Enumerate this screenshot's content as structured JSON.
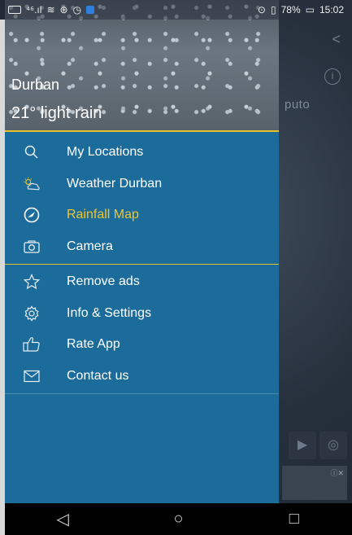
{
  "status_bar": {
    "left_icons": [
      "sim-icon",
      "signal-icon",
      "wifi-icon",
      "sync-icon",
      "clock-icon",
      "app-icon"
    ],
    "signal_text": "⁴⁶.ıl",
    "right_text": "78%",
    "time": "15:02"
  },
  "header": {
    "city": "Durban",
    "weather": "21° light rain"
  },
  "menu": {
    "items": [
      {
        "label": "My Locations",
        "icon": "search-icon"
      },
      {
        "label": "Weather Durban",
        "icon": "partly-cloudy-icon"
      },
      {
        "label": "Rainfall Map",
        "icon": "compass-icon",
        "active": true
      },
      {
        "label": "Camera",
        "icon": "camera-icon"
      },
      {
        "label": "Remove ads",
        "icon": "star-icon"
      },
      {
        "label": "Info & Settings",
        "icon": "gear-icon"
      },
      {
        "label": "Rate App",
        "icon": "thumbs-up-icon"
      },
      {
        "label": "Contact us",
        "icon": "envelope-icon"
      }
    ]
  },
  "map_background": {
    "place_label": "puto"
  },
  "colors": {
    "drawer": "#1b6c9b",
    "accent": "#e8c12b",
    "active_item": "#f2c52a"
  }
}
